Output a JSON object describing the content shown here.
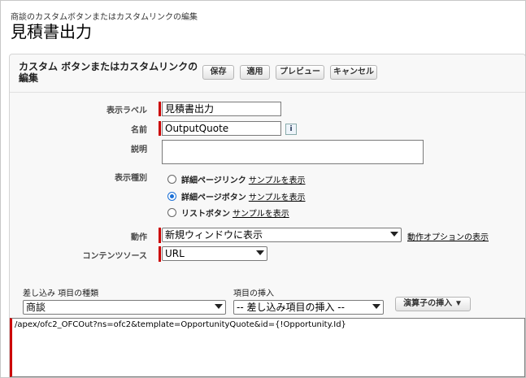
{
  "header": {
    "breadcrumb": "商談のカスタムボタンまたはカスタムリンクの編集",
    "title": "見積書出力"
  },
  "panel": {
    "title": "カスタム ボタンまたはカスタムリンクの編集",
    "buttons": {
      "save": "保存",
      "apply": "適用",
      "preview": "プレビュー",
      "cancel": "キャンセル"
    }
  },
  "form": {
    "label": {
      "label": "表示ラベル",
      "value": "見積書出力"
    },
    "name": {
      "label": "名前",
      "value": "OutputQuote",
      "info_icon": "i"
    },
    "description": {
      "label": "説明",
      "value": ""
    },
    "display_type": {
      "label": "表示種別",
      "options": [
        {
          "label": "詳細ページリンク",
          "link": "サンプルを表示",
          "selected": false
        },
        {
          "label": "詳細ページボタン",
          "link": "サンプルを表示",
          "selected": true
        },
        {
          "label": "リストボタン",
          "link": "サンプルを表示",
          "selected": false
        }
      ]
    },
    "behavior": {
      "label": "動作",
      "value": "新規ウィンドウに表示",
      "link": "動作オプションの表示"
    },
    "content_source": {
      "label": "コンテンツソース",
      "value": "URL"
    }
  },
  "merge": {
    "field_type_label": "差し込み 項目の種類",
    "field_type_value": "商談",
    "insert_label": "項目の挿入",
    "insert_value": "-- 差し込み項目の挿入 --",
    "operator_button": "演算子の挿入",
    "body_text": "/apex/ofc2_OFCOut?ns=ofc2&template=OpportunityQuote&id={!Opportunity.Id}"
  },
  "colors": {
    "required": "#c00000",
    "radio_selected": "#1a6fd6"
  }
}
